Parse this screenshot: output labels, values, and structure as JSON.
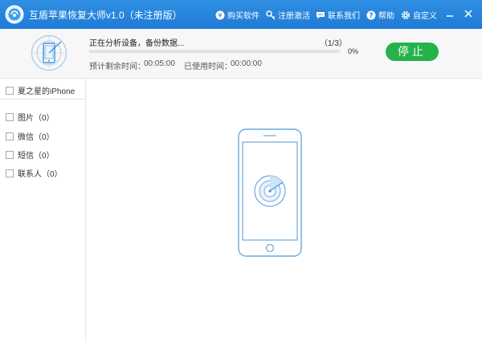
{
  "app": {
    "title": "互盾苹果恢复大师v1.0（未注册版）",
    "brand_color": "#1f7bd6",
    "accent_green": "#25b24a"
  },
  "menu": {
    "items": [
      {
        "label": "购买软件",
        "icon": "yen-icon"
      },
      {
        "label": "注册激活",
        "icon": "key-icon"
      },
      {
        "label": "联系我们",
        "icon": "chat-icon"
      },
      {
        "label": "帮助",
        "icon": "help-icon"
      },
      {
        "label": "自定义",
        "icon": "gear-icon"
      }
    ],
    "window_buttons": [
      "minimize-icon",
      "close-icon"
    ]
  },
  "status": {
    "text": "正在分析设备，备份数据...",
    "step": "（1/3）",
    "progress_percent": 0,
    "percent_label": "0%",
    "remaining_label": "预计剩余时间：",
    "remaining_value": "00:05:00",
    "used_label": "已使用时间：",
    "used_value": "00:00:00",
    "stop_button": "停止"
  },
  "sidebar": {
    "device": "夏之星的iPhone",
    "categories": [
      {
        "label": "图片（0）"
      },
      {
        "label": "微信（0）"
      },
      {
        "label": "短信（0）"
      },
      {
        "label": "联系人（0）"
      }
    ]
  },
  "main": {
    "illustration": "phone-scanning-icon"
  }
}
